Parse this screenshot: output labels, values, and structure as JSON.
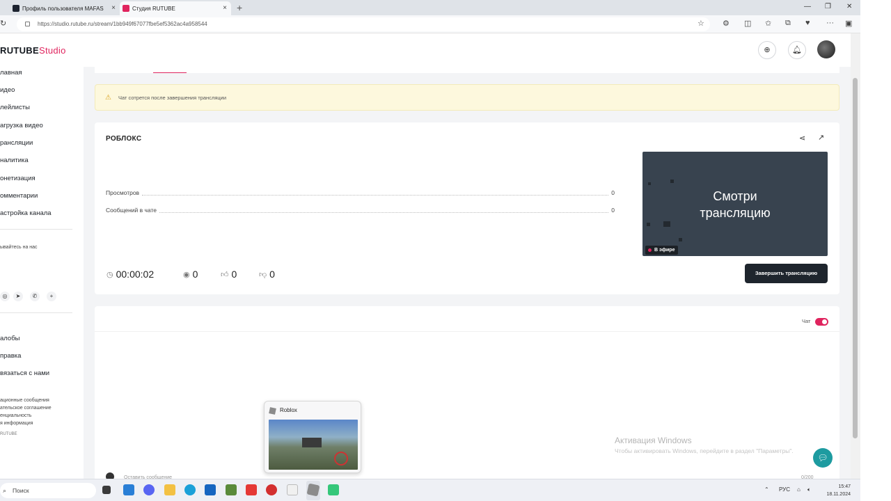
{
  "browser": {
    "tabs": [
      {
        "label": "Профиль пользователя MAFAS"
      },
      {
        "label": "Студия RUTUBE"
      }
    ],
    "url": "https://studio.rutube.ru/stream/1bb949f67077fbe5ef5362ac4a958544"
  },
  "header": {
    "logo_main": "RUTUBE",
    "logo_studio": "Studio"
  },
  "sidebar": {
    "items": [
      {
        "label": "лавная"
      },
      {
        "label": "идео"
      },
      {
        "label": "лейлисты"
      },
      {
        "label": "агрузка видео"
      },
      {
        "label": "рансляции"
      },
      {
        "label": "налитика"
      },
      {
        "label": "онетизация"
      },
      {
        "label": "омментарии"
      },
      {
        "label": "астройка канала"
      }
    ],
    "follow_label": "ывайтесь на нас",
    "help_items": [
      {
        "label": "алобы"
      },
      {
        "label": "правка"
      },
      {
        "label": "вязаться с нами"
      }
    ],
    "footer_links": [
      {
        "label": "ационные сообщения"
      },
      {
        "label": "ательское соглашение"
      },
      {
        "label": "енциальность"
      },
      {
        "label": "я информация"
      },
      {
        "label": "RUTUBE"
      }
    ]
  },
  "banner": {
    "text": "Чат сотрется после завершения трансляции"
  },
  "stream": {
    "title": "РОБЛОКС",
    "stats": [
      {
        "label": "Просмотров",
        "value": "0"
      },
      {
        "label": "Сообщений в чате",
        "value": "0"
      }
    ],
    "timer": "00:00:02",
    "viewers": "0",
    "likes": "0",
    "dislikes": "0",
    "preview_text_line1": "Смотри",
    "preview_text_line2": "трансляцию",
    "live_badge": "В эфире",
    "end_button": "Завершить трансляцию"
  },
  "chat": {
    "label": "Чат",
    "enabled": true,
    "input_placeholder": "Оставить сообщение",
    "char_count": "0/200"
  },
  "watermark": {
    "line1": "Активация Windows",
    "line2": "Чтобы активировать Windows, перейдите в раздел \"Параметры\"."
  },
  "taskbar": {
    "search_placeholder": "Поиск",
    "language": "РУС",
    "time": "15:47",
    "date": "18.11.2024"
  },
  "thumbnail_popup": {
    "title": "Roblox"
  },
  "colors": {
    "accent": "#e0245e",
    "dark_button": "#1e252d",
    "preview_bg": "#38434f",
    "banner_bg": "#fdf8dd",
    "fab": "#1d9ba0"
  }
}
